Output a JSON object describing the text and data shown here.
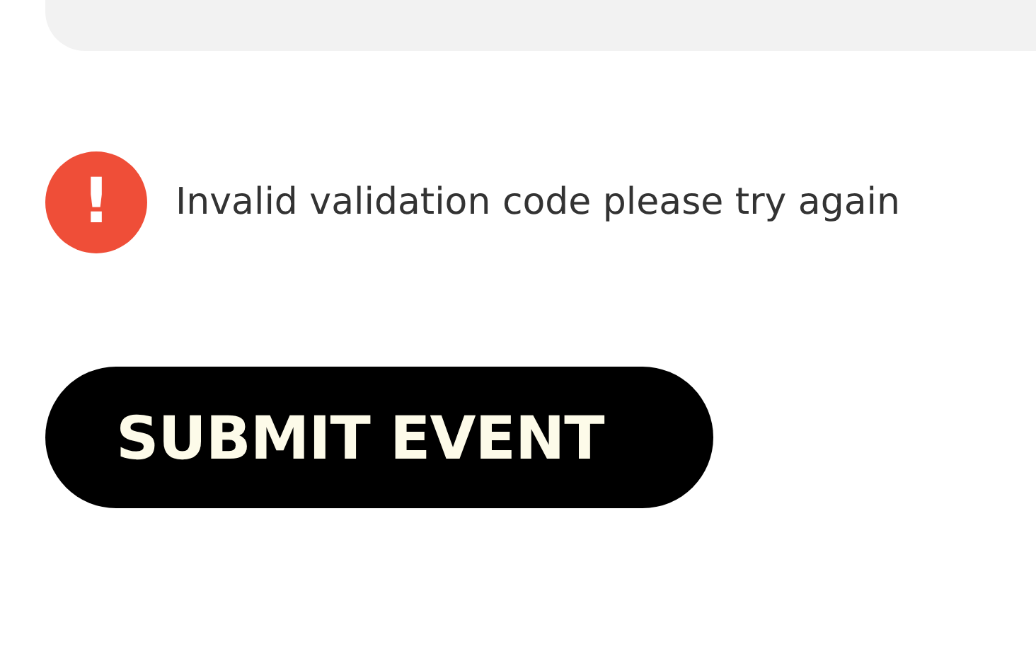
{
  "error": {
    "icon": "!",
    "message": "Invalid validation code please try again"
  },
  "submit_button": {
    "label": "SUBMIT EVENT"
  }
}
